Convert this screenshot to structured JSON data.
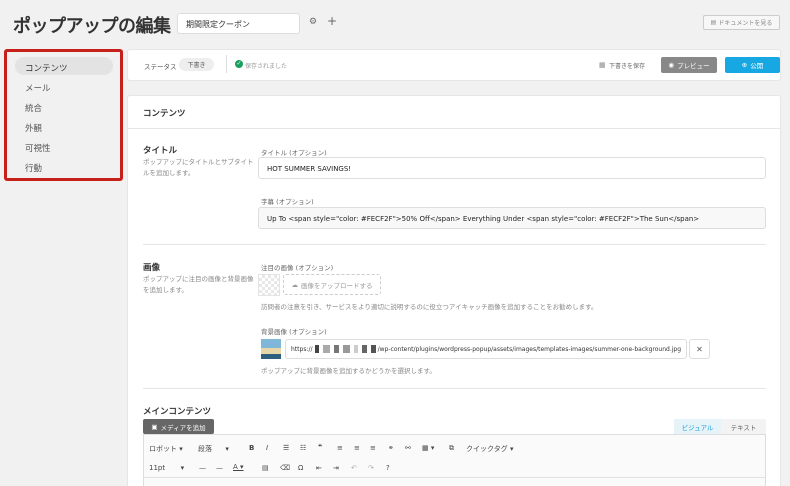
{
  "header": {
    "title": "ポップアップの編集",
    "name_value": "期間限定クーポン",
    "docs_label": "ドキュメントを見る"
  },
  "sidebar": {
    "items": [
      {
        "label": "コンテンツ",
        "active": true
      },
      {
        "label": "メール"
      },
      {
        "label": "統合"
      },
      {
        "label": "外観"
      },
      {
        "label": "可視性"
      },
      {
        "label": "行動"
      }
    ],
    "highlight_color": "#c7201b"
  },
  "topbar": {
    "status_label": "ステータス",
    "status_badge": "下書き",
    "saved_text": "保存されました",
    "draft_label": "下書きを保存",
    "preview_label": "プレビュー",
    "publish_label": "公開",
    "publish_color": "#17a8e3"
  },
  "content": {
    "heading": "コンテンツ",
    "title_section": {
      "title": "タイトル",
      "desc": "ポップアップにタイトルとサブタイトルを追加します。",
      "title_label": "タイトル (オプション)",
      "title_value": "HOT SUMMER SAVINGS!",
      "subtitle_label": "字幕 (オプション)",
      "subtitle_value": "Up To <span style=\"color: #FECF2F\">50% Off</span> Everything Under <span style=\"color: #FECF2F\">The Sun</span>"
    },
    "image_section": {
      "title": "画像",
      "desc": "ポップアップに注目の画像と背景画像を追加します。",
      "featured_label": "注目の画像 (オプション)",
      "upload_label": "画像をアップロードする",
      "featured_help": "訪問者の注意を引き、サービスをより適切に説明するのに役立つアイキャッチ画像を追加することをお勧めします。",
      "bg_label": "背景画像 (オプション)",
      "bg_url_prefix": "https://",
      "bg_url_suffix": "/wp-content/plugins/wordpress-popup/assets/images/templates-images/summer-one-background.jpg",
      "bg_help": "ポップアップに背景画像を追加するかどうかを選択します。"
    },
    "main_content": {
      "title": "メインコンテンツ",
      "media_label": "メディアを追加",
      "tab_visual": "ビジュアル",
      "tab_text": "テキスト",
      "font_select": "ロボット",
      "format_select": "段落",
      "quicktag": "クイックタグ",
      "size_select": "11pt"
    }
  }
}
